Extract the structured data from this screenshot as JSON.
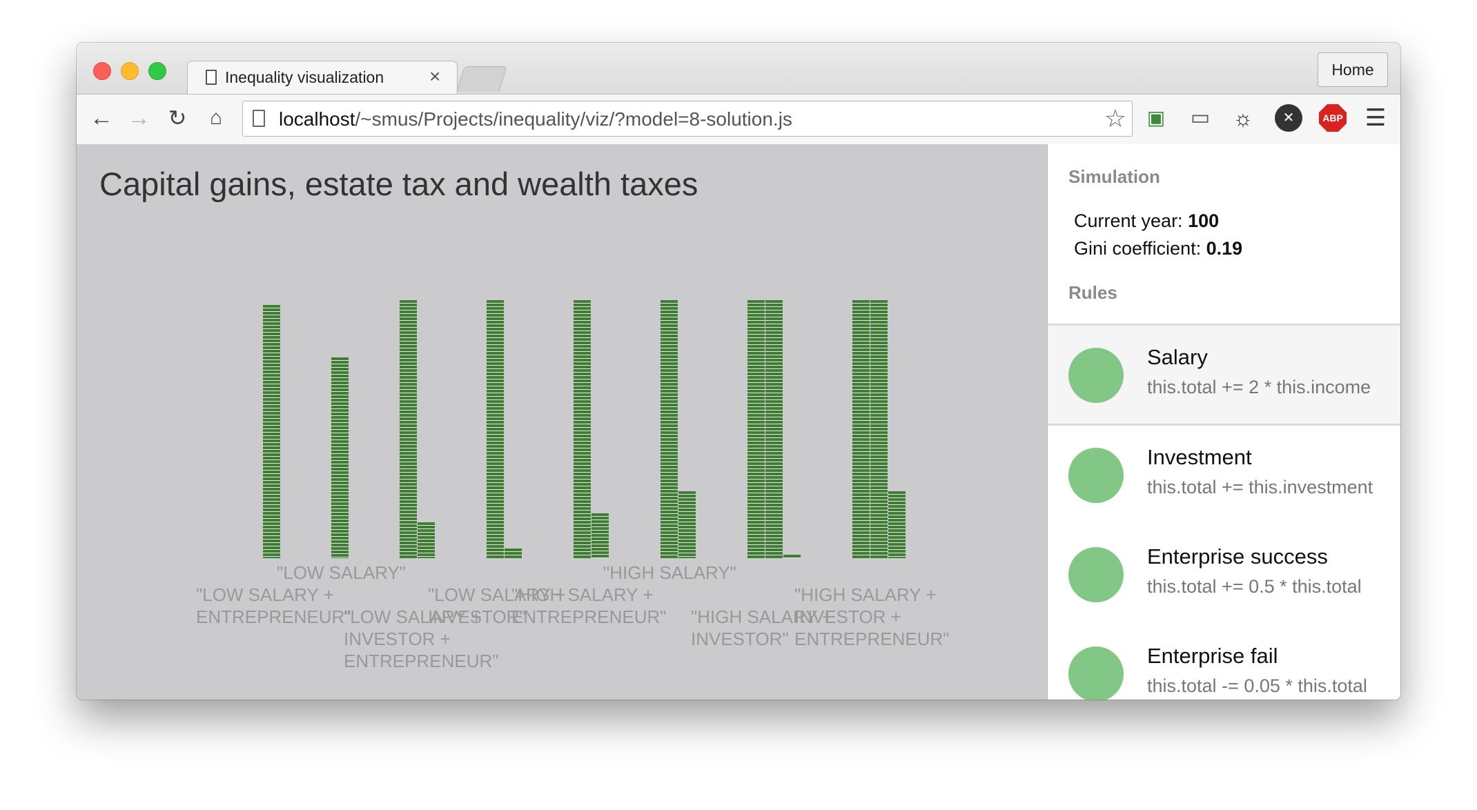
{
  "browser": {
    "tab_title": "Inequality visualization",
    "tab_close": "×",
    "home_label": "Home",
    "url_host": "localhost",
    "url_path": "/~smus/Projects/inequality/viz/?model=8-solution.js",
    "abp_label": "ABP"
  },
  "page": {
    "title": "Capital gains, estate tax and wealth taxes"
  },
  "chart_data": {
    "type": "bar",
    "description_units": "wealth (no axis values shown)",
    "categories": [
      "\"LOW SALARY\"",
      "\"LOW SALARY + ENTREPRENEUR\"",
      "\"LOW SALARY + INVESTOR\"",
      "\"LOW SALARY + INVESTOR + ENTREPRENEUR\"",
      "\"HIGH SALARY\"",
      "\"HIGH SALARY + ENTREPRENEUR\"",
      "\"HIGH SALARY + INVESTOR\"",
      "\"HIGH SALARY + INVESTOR + ENTREPRENEUR\""
    ],
    "groups": [
      {
        "label": "\"LOW SALARY\"",
        "bars": [
          270
        ]
      },
      {
        "label": "\"LOW SALARY + ENTREPRENEUR\"",
        "bars": [
          214
        ]
      },
      {
        "label": "\"LOW SALARY + INVESTOR\"",
        "bars": [
          275,
          38
        ]
      },
      {
        "label": "\"LOW SALARY + INVESTOR + ENTREPRENEUR\"",
        "bars": [
          275,
          10
        ]
      },
      {
        "label": "\"HIGH SALARY\"",
        "bars": [
          275,
          48
        ]
      },
      {
        "label": "\"HIGH SALARY + ENTREPRENEUR\"",
        "bars": [
          275,
          71
        ]
      },
      {
        "label": "\"HIGH SALARY + INVESTOR\"",
        "bars": [
          275,
          275,
          4
        ]
      },
      {
        "label": "\"HIGH SALARY + INVESTOR + ENTREPRENEUR\"",
        "bars": [
          275,
          275,
          71
        ]
      }
    ],
    "label_lines": [
      [
        "\"LOW SALARY\""
      ],
      [
        "\"LOW SALARY +",
        "ENTREPRENEUR\""
      ],
      [
        "\"LOW SALARY +",
        "INVESTOR\""
      ],
      [
        "\"LOW SALARY +",
        "INVESTOR +",
        "ENTREPRENEUR\""
      ],
      [
        "\"HIGH SALARY\""
      ],
      [
        "\"HIGH SALARY +",
        "ENTREPRENEUR\""
      ],
      [
        "\"HIGH SALARY +",
        "INVESTOR\""
      ],
      [
        "\"HIGH SALARY +",
        "INVESTOR +",
        "ENTREPRENEUR\""
      ]
    ],
    "bar_color": "#3f7d34",
    "title": "",
    "xlabel": "",
    "ylabel": ""
  },
  "sidebar": {
    "simulation_title": "Simulation",
    "year_label": "Current year:",
    "year_value": "100",
    "gini_label": "Gini coefficient:",
    "gini_value": "0.19",
    "rules_title": "Rules",
    "rules": [
      {
        "name": "Salary",
        "code": "this.total += 2 * this.income"
      },
      {
        "name": "Investment",
        "code": "this.total += this.investment"
      },
      {
        "name": "Enterprise success",
        "code": "this.total += 0.5 * this.total"
      },
      {
        "name": "Enterprise fail",
        "code": "this.total -= 0.05 * this.total"
      }
    ],
    "rule_color": "#82c785"
  }
}
